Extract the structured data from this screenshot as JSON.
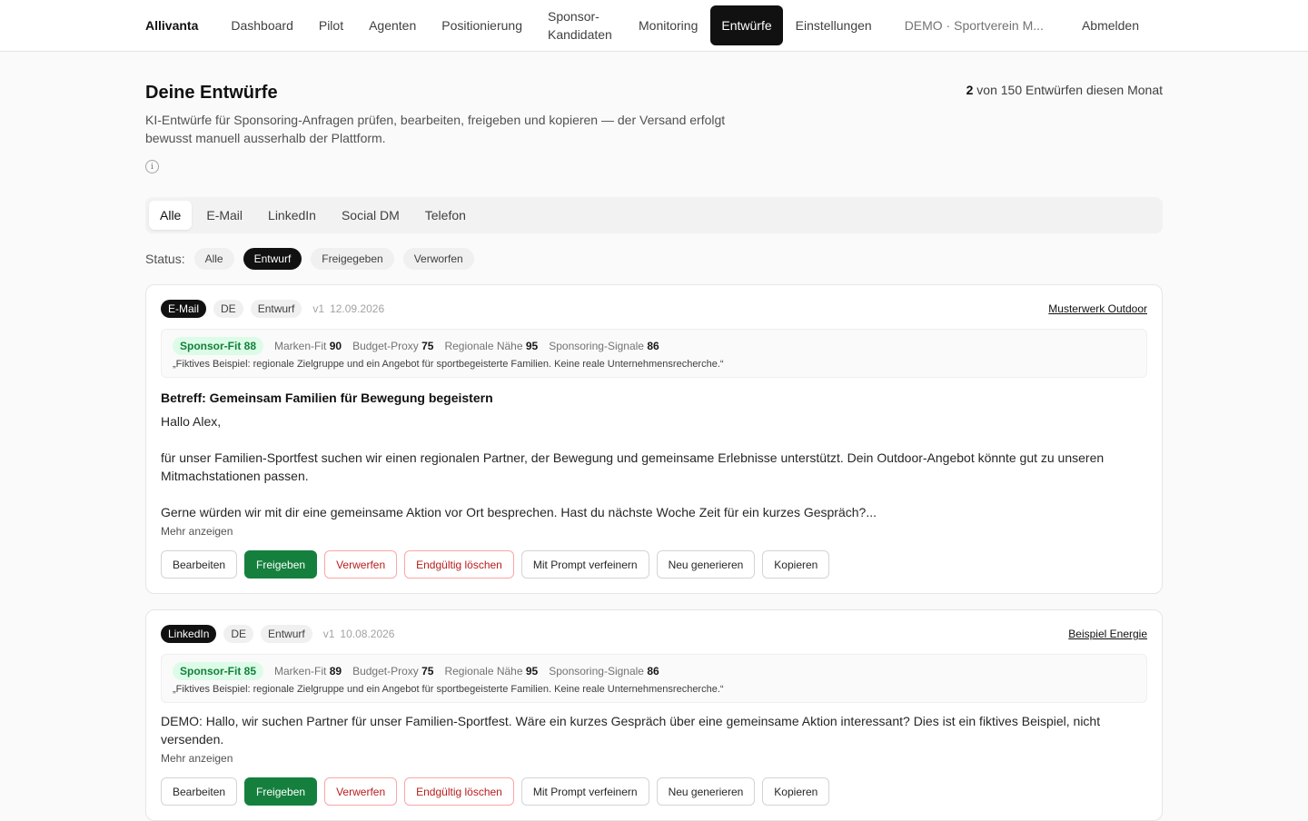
{
  "nav": {
    "brand": "Allivanta",
    "items": [
      "Dashboard",
      "Pilot",
      "Agenten",
      "Positionierung",
      "Sponsor-Kandidaten",
      "Monitoring",
      "Entwürfe",
      "Einstellungen"
    ],
    "active": "Entwürfe",
    "org": "DEMO · Sportverein M...",
    "logout": "Abmelden"
  },
  "header": {
    "title": "Deine Entwürfe",
    "subtitle": "KI-Entwürfe für Sponsoring-Anfragen prüfen, bearbeiten, freigeben und kopieren — der Versand erfolgt bewusst manuell ausserhalb der Plattform.",
    "quota_count": "2",
    "quota_text": " von 150 Entwürfen diesen Monat",
    "info_glyph": "i"
  },
  "tabs": [
    "Alle",
    "E-Mail",
    "LinkedIn",
    "Social DM",
    "Telefon"
  ],
  "active_tab": "Alle",
  "status": {
    "label": "Status:",
    "options": [
      "Alle",
      "Entwurf",
      "Freigegeben",
      "Verworfen"
    ],
    "active": "Entwurf"
  },
  "actions": [
    "Bearbeiten",
    "Freigeben",
    "Verwerfen",
    "Endgültig löschen",
    "Mit Prompt verfeinern",
    "Neu generieren",
    "Kopieren"
  ],
  "more_label": "Mehr anzeigen",
  "drafts": [
    {
      "channel": "E-Mail",
      "lang": "DE",
      "status": "Entwurf",
      "version": "v1",
      "date": "12.09.2026",
      "company": "Musterwerk Outdoor",
      "fit": "Sponsor-Fit 88",
      "metrics": [
        {
          "label": "Marken-Fit",
          "value": "90"
        },
        {
          "label": "Budget-Proxy",
          "value": "75"
        },
        {
          "label": "Regionale Nähe",
          "value": "95"
        },
        {
          "label": "Sponsoring-Signale",
          "value": "86"
        }
      ],
      "quote": "„Fiktives Beispiel: regionale Zielgruppe und ein Angebot für sportbegeisterte Familien. Keine reale Unternehmensrecherche.“",
      "subject": "Betreff: Gemeinsam Familien für Bewegung begeistern",
      "paragraphs": [
        "Hallo Alex,",
        "für unser Familien-Sportfest suchen wir einen regionalen Partner, der Bewegung und gemeinsame Erlebnisse unterstützt. Dein Outdoor-Angebot könnte gut zu unseren Mitmachstationen passen.",
        "Gerne würden wir mit dir eine gemeinsame Aktion vor Ort besprechen. Hast du nächste Woche Zeit für ein kurzes Gespräch?..."
      ]
    },
    {
      "channel": "LinkedIn",
      "lang": "DE",
      "status": "Entwurf",
      "version": "v1",
      "date": "10.08.2026",
      "company": "Beispiel Energie",
      "fit": "Sponsor-Fit 85",
      "metrics": [
        {
          "label": "Marken-Fit",
          "value": "89"
        },
        {
          "label": "Budget-Proxy",
          "value": "75"
        },
        {
          "label": "Regionale Nähe",
          "value": "95"
        },
        {
          "label": "Sponsoring-Signale",
          "value": "86"
        }
      ],
      "quote": "„Fiktives Beispiel: regionale Zielgruppe und ein Angebot für sportbegeisterte Familien. Keine reale Unternehmensrecherche.“",
      "message": "DEMO: Hallo, wir suchen Partner für unser Familien-Sportfest. Wäre ein kurzes Gespräch über eine gemeinsame Aktion interessant? Dies ist ein fiktives Beispiel, nicht versenden."
    }
  ]
}
